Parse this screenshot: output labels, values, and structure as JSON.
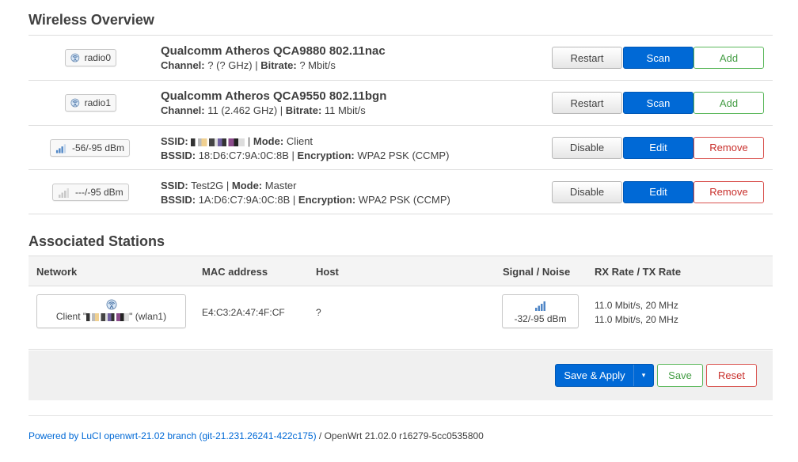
{
  "wireless": {
    "title": "Wireless Overview",
    "rows": [
      {
        "badge": "radio0",
        "title": "Qualcomm Atheros QCA9880 802.11nac",
        "channel_label": "Channel:",
        "channel_value": "? (? GHz)",
        "bitrate_label": "Bitrate:",
        "bitrate_value": "? Mbit/s",
        "buttons": [
          "Restart",
          "Scan",
          "Add"
        ]
      },
      {
        "badge": "radio1",
        "title": "Qualcomm Atheros QCA9550 802.11bgn",
        "channel_label": "Channel:",
        "channel_value": "11 (2.462 GHz)",
        "bitrate_label": "Bitrate:",
        "bitrate_value": "11 Mbit/s",
        "buttons": [
          "Restart",
          "Scan",
          "Add"
        ]
      },
      {
        "badge": "-56/-95 dBm",
        "ssid_label": "SSID:",
        "ssid_value": "",
        "mode_label": "Mode:",
        "mode_value": "Client",
        "bssid_label": "BSSID:",
        "bssid_value": "18:D6:C7:9A:0C:8B",
        "encryption_label": "Encryption:",
        "encryption_value": "WPA2 PSK (CCMP)",
        "buttons": [
          "Disable",
          "Edit",
          "Remove"
        ]
      },
      {
        "badge": "---/-95 dBm",
        "ssid_label": "SSID:",
        "ssid_value": "Test2G",
        "mode_label": "Mode:",
        "mode_value": "Master",
        "bssid_label": "BSSID:",
        "bssid_value": "1A:D6:C7:9A:0C:8B",
        "encryption_label": "Encryption:",
        "encryption_value": "WPA2 PSK (CCMP)",
        "buttons": [
          "Disable",
          "Edit",
          "Remove"
        ]
      }
    ]
  },
  "stations": {
    "title": "Associated Stations",
    "columns": [
      "Network",
      "MAC address",
      "Host",
      "Signal / Noise",
      "RX Rate / TX Rate"
    ],
    "rows": [
      {
        "network_prefix": "Client \"",
        "network_suffix": "\" (wlan1)",
        "mac": "E4:C3:2A:47:4F:CF",
        "host": "?",
        "signal": "-32/-95 dBm",
        "rx_rate": "11.0 Mbit/s, 20 MHz",
        "tx_rate": "11.0 Mbit/s, 20 MHz"
      }
    ]
  },
  "actions": {
    "save_apply": "Save & Apply",
    "dropdown": "▾",
    "save": "Save",
    "reset": "Reset"
  },
  "footer": {
    "luci_link": "Powered by LuCI openwrt-21.02 branch (git-21.231.26241-422c175)",
    "separator": " / ",
    "version": "OpenWrt 21.02.0 r16279-5cc0535800"
  },
  "colors": {
    "primary": "#0069d6",
    "positive": "#5cb85c",
    "negative": "#d9534f"
  },
  "icons": {
    "radio": "wifi-radio-icon",
    "signal_good": "signal-strength-icon",
    "signal_none": "signal-none-icon"
  }
}
